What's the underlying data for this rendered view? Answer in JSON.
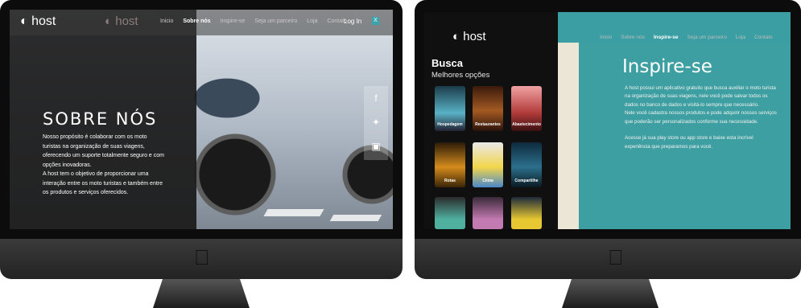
{
  "left_monitor": {
    "nav": {
      "logo": "host",
      "logo_ghost": "host",
      "links": [
        "Inicio",
        "Sobre nós",
        "Inspire-se",
        "Seja um parceiro",
        "Loja",
        "Contato"
      ],
      "active_link": "Sobre nós",
      "login": "Log In",
      "close": "X"
    },
    "hero": {
      "title": "SOBRE NÓS",
      "text": "Nosso propósito é colaborar com os moto turistas na organização de suas viagens, oferecendo um suporte totalmente seguro e com opções inovadoras.\nA host tem o objetivo de proporcionar uma interação entre os moto turistas e também entre os produtos e serviços oferecidos."
    },
    "social_icons": [
      "facebook-icon",
      "twitter-icon",
      "instagram-icon"
    ]
  },
  "right_monitor": {
    "nav": {
      "logo": "host",
      "links": [
        "Inicio",
        "Sobre nós",
        "Inspire-se",
        "Seja um parceiro",
        "Loja",
        "Contato"
      ],
      "active_link": "Inspire-se"
    },
    "sidebar": {
      "title": "Busca",
      "subtitle": "Melhores opções",
      "tiles": [
        {
          "label": "Hospedagem"
        },
        {
          "label": "Restaurantes"
        },
        {
          "label": "Abastecimento"
        },
        {
          "label": "Rotas"
        },
        {
          "label": "Clima"
        },
        {
          "label": "Compartilhe"
        },
        {
          "label": ""
        },
        {
          "label": ""
        },
        {
          "label": ""
        }
      ]
    },
    "inspire": {
      "title": "Inspire-se",
      "text": "A host possui um aplicativo gratuito que busca auxiliar o moto turista na organização de suas viagens, nele você pode salvar todos os dados no banco de dados e visitá-lo sempre que necessário.\nNele você cadastra nossos produtos e pode adquirir nossos serviços que poderão ser personalizados conforme sua necessidade.\n\nAcesse já sua play store ou app store e baixe esta incrível experiência que preparamos para você."
    }
  },
  "colors": {
    "accent": "#3aa4ad",
    "teal": "#3d9fa1",
    "bezel": "#0c0c0c"
  }
}
